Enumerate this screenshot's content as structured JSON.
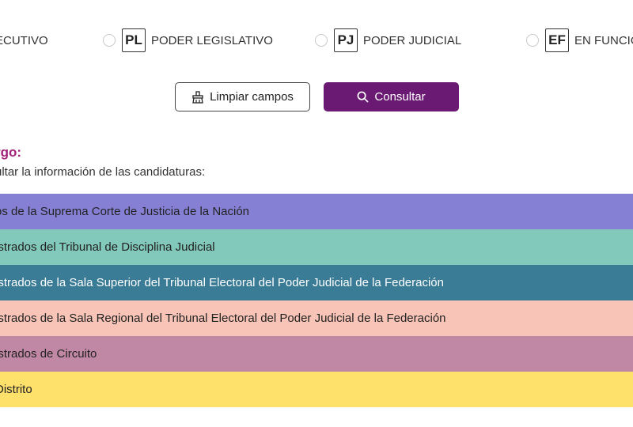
{
  "options": [
    {
      "label": "ECUTIVO",
      "badge": ""
    },
    {
      "label": "PODER LEGISLATIVO",
      "badge": "PL"
    },
    {
      "label": "PODER JUDICIAL",
      "badge": "PJ"
    },
    {
      "label": "EN FUNCIO",
      "badge": "EF"
    }
  ],
  "buttons": {
    "clear_label": "Limpiar campos",
    "search_label": "Consultar"
  },
  "section": {
    "heading": "rgo:",
    "instruction": "ultar la información de las candidaturas:"
  },
  "bands": [
    {
      "label": "os de la Suprema Corte de Justicia de la Nación",
      "color": "#8680d5",
      "text": "#222222"
    },
    {
      "label": "istrados del Tribunal de Disciplina Judicial",
      "color": "#82c8bb",
      "text": "#222222"
    },
    {
      "label": "istrados de la Sala Superior del Tribunal Electoral del Poder Judicial de la Federación",
      "color": "#3a7b96",
      "text": "#ffffff"
    },
    {
      "label": "istrados de la Sala Regional del Tribunal Electoral del Poder Judicial de la Federación",
      "color": "#f7c4b7",
      "text": "#222222"
    },
    {
      "label": "istrados de Circuito",
      "color": "#c188a5",
      "text": "#222222"
    },
    {
      "label": " Distrito",
      "color": "#fee16b",
      "text": "#222222"
    }
  ],
  "colors": {
    "accent": "#6b1a73",
    "heading": "#a3217a"
  }
}
